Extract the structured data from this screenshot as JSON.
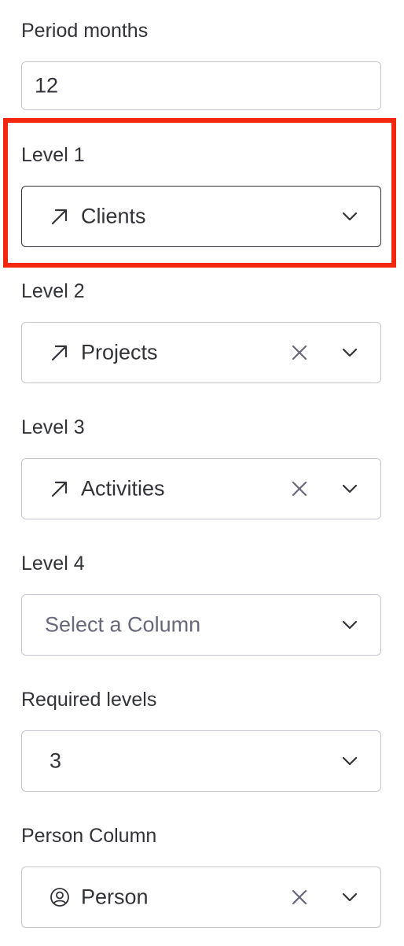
{
  "period": {
    "label": "Period months",
    "value": "12"
  },
  "levels": [
    {
      "label": "Level 1",
      "value": "Clients",
      "icon": "arrow-up-right-icon",
      "clearable": false
    },
    {
      "label": "Level 2",
      "value": "Projects",
      "icon": "arrow-up-right-icon",
      "clearable": true
    },
    {
      "label": "Level 3",
      "value": "Activities",
      "icon": "arrow-up-right-icon",
      "clearable": true
    },
    {
      "label": "Level 4",
      "placeholder": "Select a Column"
    }
  ],
  "required_levels": {
    "label": "Required levels",
    "value": "3"
  },
  "person_column": {
    "label": "Person Column",
    "value": "Person",
    "icon": "person-circle-icon"
  },
  "colors": {
    "highlight": "#f2270d",
    "text": "#323338",
    "border": "#c5c7d0",
    "placeholder": "#676879"
  }
}
